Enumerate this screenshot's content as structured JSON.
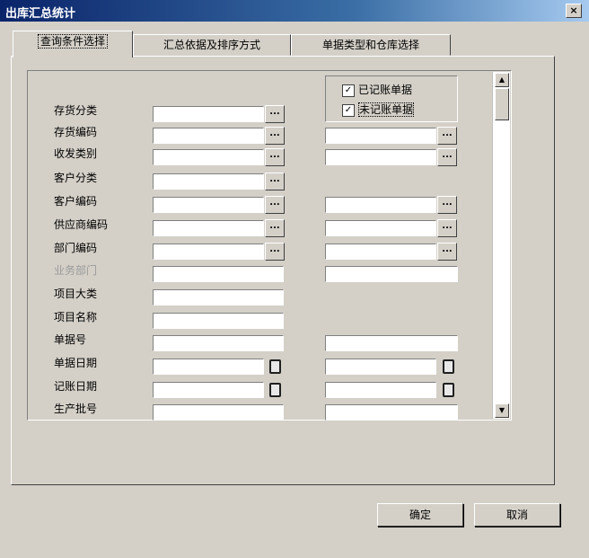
{
  "window": {
    "title": "出库汇总统计",
    "close_glyph": "×"
  },
  "tabs": [
    {
      "label": "查询条件选择"
    },
    {
      "label": "汇总依据及排序方式"
    },
    {
      "label": "单据类型和仓库选择"
    }
  ],
  "checkboxes": [
    {
      "label": "已记账单据",
      "checked": true
    },
    {
      "label": "未记账单据",
      "checked": true
    }
  ],
  "fields": [
    {
      "label": "存货分类"
    },
    {
      "label": "存货编码"
    },
    {
      "label": "收发类别"
    },
    {
      "label": "客户分类"
    },
    {
      "label": "客户编码"
    },
    {
      "label": "供应商编码"
    },
    {
      "label": "部门编码"
    },
    {
      "label": "业务部门",
      "disabled": true
    },
    {
      "label": "项目大类"
    },
    {
      "label": "项目名称"
    },
    {
      "label": "单据号"
    },
    {
      "label": "单据日期"
    },
    {
      "label": "记账日期"
    },
    {
      "label": "生产批号"
    }
  ],
  "glyphs": {
    "ellipsis": "...",
    "check": "✓",
    "scroll_up": "▲",
    "scroll_down": "▼"
  },
  "buttons": {
    "ok": "确定",
    "cancel": "取消"
  }
}
